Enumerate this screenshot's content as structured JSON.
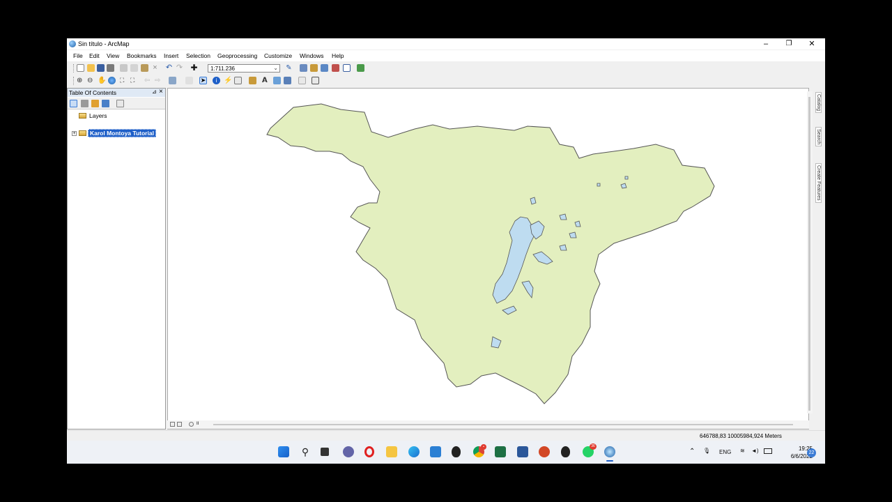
{
  "window": {
    "title": "Sin título - ArcMap",
    "minimize": "–",
    "restore": "❐",
    "close": "✕"
  },
  "menu": [
    "File",
    "Edit",
    "View",
    "Bookmarks",
    "Insert",
    "Selection",
    "Geoprocessing",
    "Customize",
    "Windows",
    "Help"
  ],
  "toolbar": {
    "scale_value": "1:711.236",
    "scale_arrow": "⌄"
  },
  "toc": {
    "title": "Table Of Contents",
    "pin": "⊿",
    "close": "×",
    "root_label": "Layers",
    "layer_label": "Karol Montoya Tutorial"
  },
  "dock_tabs": [
    "Catalog",
    "Search",
    "Create Features"
  ],
  "status": {
    "coords": "646788,83  10005984,924 Meters"
  },
  "taskbar": {
    "lang": "ENG",
    "time": "19:25",
    "date": "6/6/2022",
    "notifications": "22",
    "chrome_badge": "•",
    "whatsapp_badge": "36"
  },
  "colors": {
    "polygon_fill": "#e3efbf",
    "polygon_stroke": "#555555",
    "lake_fill": "#bedcf0",
    "selection": "#1e5fc8"
  }
}
